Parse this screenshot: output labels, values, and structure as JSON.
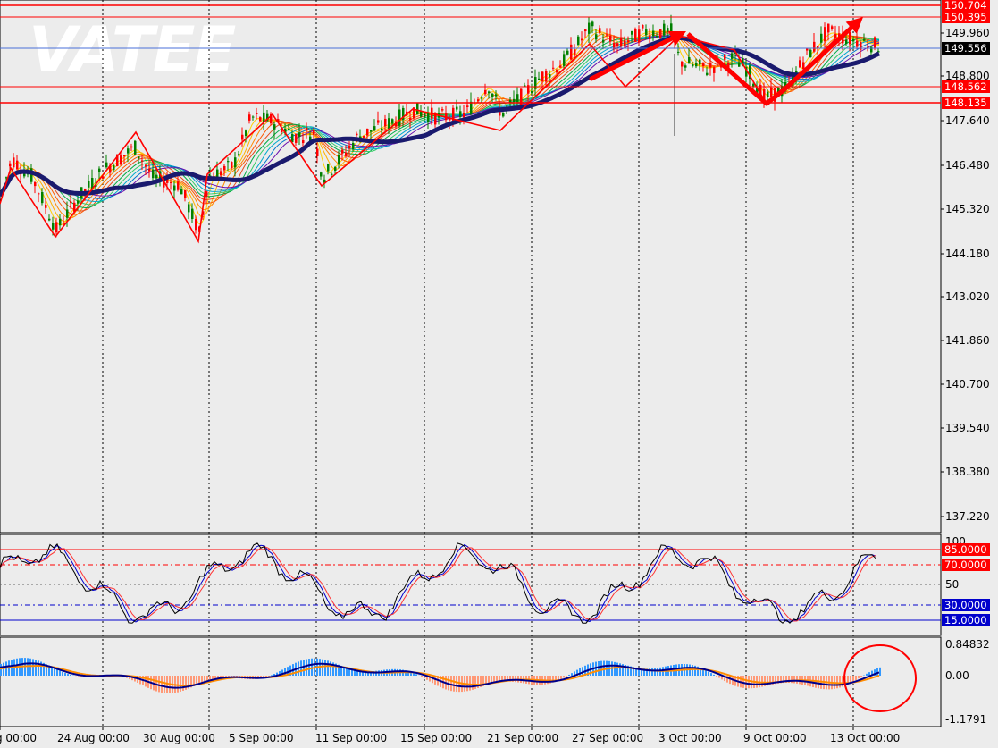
{
  "logo": "VATEE",
  "colors": {
    "background": "#ececec",
    "bull_candle": "#008000",
    "bear_candle": "#ff0000",
    "zigzag": "#ff0000",
    "ma_slow": "#1a1a6e",
    "price_line": "#4a6fd8",
    "level_line": "#ff0000",
    "stoch_main": "#000000",
    "stoch_signal": "#0000cc",
    "macd_positive": "#3399ff",
    "macd_negative": "#ff9977",
    "macd_line": "#00008b",
    "macd_signal": "#ff8c00",
    "highlight_circle": "#ff0000"
  },
  "price_axis": {
    "ticks": [
      "149.960",
      "148.800",
      "147.640",
      "146.480",
      "145.320",
      "144.180",
      "143.020",
      "141.860",
      "140.700",
      "139.540",
      "138.380",
      "137.220"
    ],
    "levels": [
      {
        "label": "150.704",
        "style": "tag-red"
      },
      {
        "label": "150.395",
        "style": "tag-red"
      },
      {
        "label": "148.562",
        "style": "tag-red"
      },
      {
        "label": "148.135",
        "style": "tag-red"
      }
    ],
    "current_price": "149.556"
  },
  "stochastic_axis": {
    "ticks": [
      "100",
      "50"
    ],
    "levels": [
      {
        "label": "85.0000",
        "style": "tag-red"
      },
      {
        "label": "70.0000",
        "style": "tag-red"
      },
      {
        "label": "30.0000",
        "style": "tag-blue"
      },
      {
        "label": "15.0000",
        "style": "tag-blue"
      }
    ]
  },
  "macd_axis": {
    "ticks": [
      "0.84832",
      "0.00",
      "-1.1791"
    ]
  },
  "time_axis": {
    "labels": [
      "g 00:00",
      "24 Aug 00:00",
      "30 Aug 00:00",
      "5 Sep 00:00",
      "11 Sep 00:00",
      "15 Sep 00:00",
      "21 Sep 00:00",
      "27 Sep 00:00",
      "3 Oct 00:00",
      "9 Oct 00:00",
      "13 Oct 00:00"
    ]
  },
  "annotation": {
    "circle_icon": "highlight-circle-icon",
    "arrow_icon": "trend-arrow-icon"
  }
}
